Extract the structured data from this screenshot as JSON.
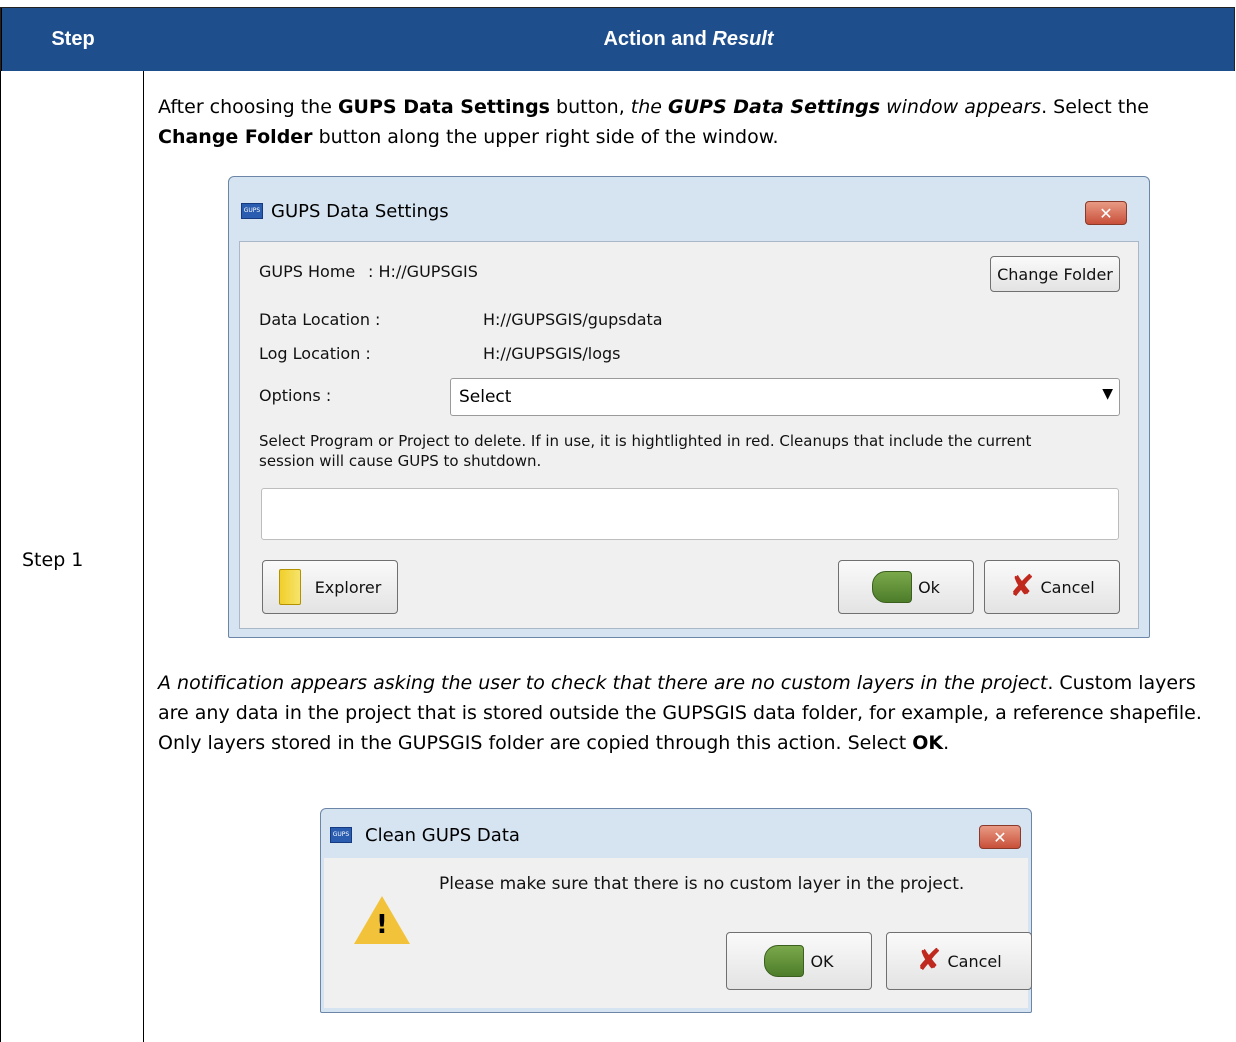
{
  "table": {
    "header_step": "Step",
    "header_action": "Action and",
    "header_result": "Result",
    "step_label": "Step 1"
  },
  "para1": {
    "t1": "After choosing the ",
    "b1": "GUPS Data Settings",
    "t2": " button, ",
    "i1": "the ",
    "bi1": "GUPS Data Settings",
    "i2": " window appears",
    "t3": ". Select the ",
    "b2": "Change Folder",
    "t4": " button along the upper right side of the window."
  },
  "dialog1": {
    "title": "GUPS Data Settings",
    "close_glyph": "✕",
    "home_label": "GUPS Home",
    "home_value": ": H://GUPSGIS",
    "change_folder": "Change Folder",
    "data_location_label": "Data Location  :",
    "data_location_value": "H://GUPSGIS/gupsdata",
    "log_location_label": "Log Location  :",
    "log_location_value": "H://GUPSGIS/logs",
    "options_label": "Options :",
    "options_value": "Select",
    "delete_help_line1": "Select Program or Project to delete. If in use, it is hightlighted in red. Cleanups that include the current",
    "delete_help_line2": "session will cause GUPS to shutdown.",
    "explorer": "Explorer",
    "ok": "Ok",
    "cancel": "Cancel"
  },
  "para2": {
    "i1": "A notification appears asking the user to check that there are no custom layers in the project",
    "t1": ". Custom layers are any data in the project that is stored outside the GUPSGIS data folder, for example, a reference shapefile. Only layers stored in the GUPSGIS folder are copied through this action. Select ",
    "b1": "OK",
    "t2": "."
  },
  "dialog2": {
    "title": "Clean GUPS Data",
    "close_glyph": "✕",
    "message": "Please make sure that there is no custom layer in the project.",
    "ok": "OK",
    "cancel": "Cancel"
  },
  "icons": {
    "app_icon_text": "GUPS",
    "x_glyph": "✘",
    "warn_glyph": "!"
  },
  "colors": {
    "header_bg": "#1f4e8c",
    "dialog_frame": "#d6e3f1",
    "close_button": "#c8503a"
  }
}
